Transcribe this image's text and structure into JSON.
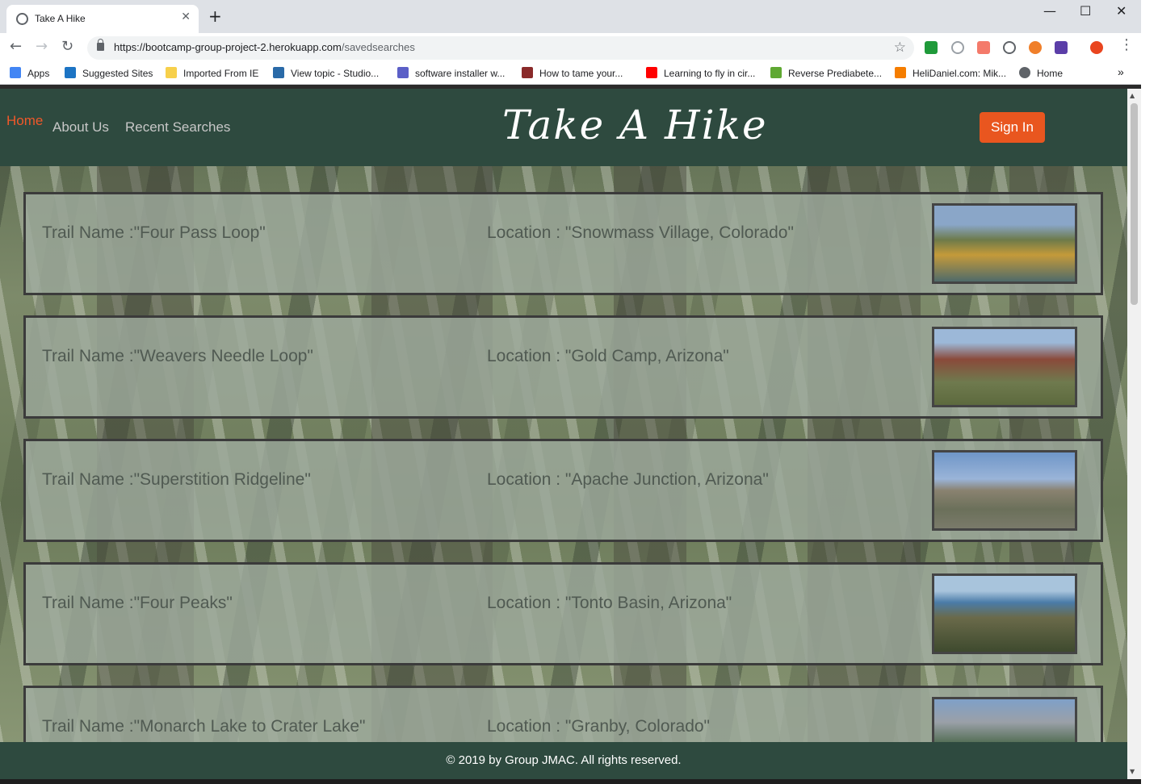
{
  "browser": {
    "tab_title": "Take A Hike",
    "new_tab": "+",
    "tab_close": "✕",
    "url_host": "https://bootcamp-group-project-2.herokuapp.com",
    "url_path": "/savedsearches",
    "bookmarks": [
      {
        "label": "Apps",
        "icon_color": "#4285f4"
      },
      {
        "label": "Suggested Sites",
        "icon_color": "#1c74c4"
      },
      {
        "label": "Imported From IE",
        "icon_color": "#f7d04b"
      },
      {
        "label": "View topic - Studio...",
        "icon_color": "#2a6aa8"
      },
      {
        "label": "software installer w...",
        "icon_color": "#5b5fc7"
      },
      {
        "label": "How to tame your...",
        "icon_color": "#8a2a2a"
      },
      {
        "label": "Learning to fly in cir...",
        "icon_color": "#ff0000"
      },
      {
        "label": "Reverse Prediabete...",
        "icon_color": "#5fa832"
      },
      {
        "label": "HeliDaniel.com: Mik...",
        "icon_color": "#f57d00"
      },
      {
        "label": "Home",
        "icon_color": "#5f6368"
      }
    ],
    "more_bookmarks": "»"
  },
  "header": {
    "nav_home": "Home",
    "nav_about": "About Us",
    "nav_recent": "Recent Searches",
    "brand": "Take A Hike",
    "sign_in": "Sign In"
  },
  "trails": [
    {
      "name": "Trail Name :\"Four Pass Loop\"",
      "location": "Location : \"Snowmass Village, Colorado\"",
      "img_colors": [
        "#8aa6c8",
        "#6d7a4a",
        "#c49a3a",
        "#4f6b6a"
      ]
    },
    {
      "name": "Trail Name :\"Weavers Needle Loop\"",
      "location": "Location : \"Gold Camp, Arizona\"",
      "img_colors": [
        "#9cb8d8",
        "#8a4a3a",
        "#6f7a4e",
        "#5d6a3e"
      ]
    },
    {
      "name": "Trail Name :\"Superstition Ridgeline\"",
      "location": "Location : \"Apache Junction, Arizona\"",
      "img_colors": [
        "#6f96c8",
        "#8a8270",
        "#6b705a",
        "#7a7a6a"
      ]
    },
    {
      "name": "Trail Name :\"Four Peaks\"",
      "location": "Location : \"Tonto Basin, Arizona\"",
      "img_colors": [
        "#a8c4dc",
        "#4a7ca8",
        "#6a6a4a",
        "#3e4a2e"
      ]
    },
    {
      "name": "Trail Name :\"Monarch Lake to Crater Lake\"",
      "location": "Location : \"Granby, Colorado\"",
      "img_colors": [
        "#7fa0c8",
        "#9aa0a8",
        "#4e6a4e",
        "#2e4a4e"
      ]
    }
  ],
  "footer": {
    "text": "© 2019 by Group JMAC. All rights reserved."
  }
}
